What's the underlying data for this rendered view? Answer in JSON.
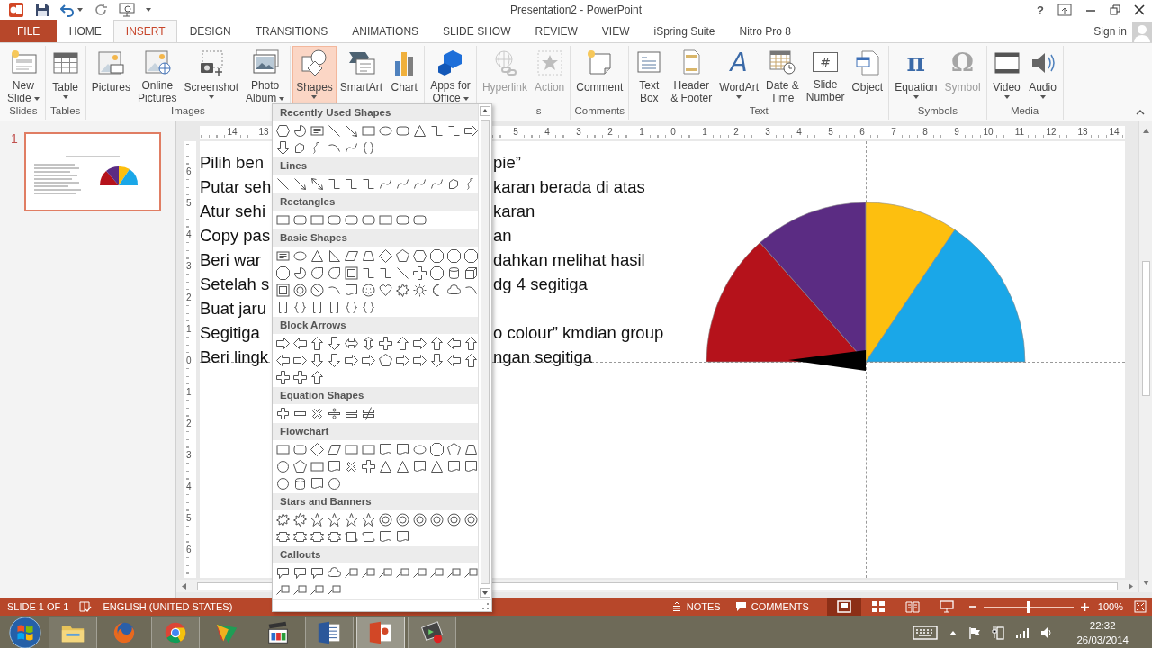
{
  "window": {
    "title": "Presentation2 - PowerPoint",
    "help": "?",
    "sign_in": "Sign in"
  },
  "tabs": [
    {
      "label": "FILE",
      "kind": "file",
      "selected": false
    },
    {
      "label": "HOME",
      "kind": "tab",
      "selected": false
    },
    {
      "label": "INSERT",
      "kind": "tab",
      "selected": true
    },
    {
      "label": "DESIGN",
      "kind": "tab",
      "selected": false
    },
    {
      "label": "TRANSITIONS",
      "kind": "tab",
      "selected": false
    },
    {
      "label": "ANIMATIONS",
      "kind": "tab",
      "selected": false
    },
    {
      "label": "SLIDE SHOW",
      "kind": "tab",
      "selected": false
    },
    {
      "label": "REVIEW",
      "kind": "tab",
      "selected": false
    },
    {
      "label": "VIEW",
      "kind": "tab",
      "selected": false
    },
    {
      "label": "iSpring Suite",
      "kind": "tab",
      "selected": false
    },
    {
      "label": "Nitro Pro 8",
      "kind": "tab",
      "selected": false
    }
  ],
  "ribbon": {
    "groups": [
      {
        "label": "Slides",
        "buttons": [
          {
            "label": "New\nSlide",
            "menu": true,
            "active": false,
            "disabled": false
          }
        ]
      },
      {
        "label": "Tables",
        "buttons": [
          {
            "label": "Table",
            "menu": true,
            "active": false,
            "disabled": false
          }
        ]
      },
      {
        "label": "Images",
        "buttons": [
          {
            "label": "Pictures",
            "menu": false,
            "active": false,
            "disabled": false
          },
          {
            "label": "Online\nPictures",
            "menu": false,
            "active": false,
            "disabled": false
          },
          {
            "label": "Screenshot",
            "menu": true,
            "active": false,
            "disabled": false
          },
          {
            "label": "Photo\nAlbum",
            "menu": true,
            "active": false,
            "disabled": false
          }
        ]
      },
      {
        "buttons": [
          {
            "label": "Shapes",
            "menu": true,
            "active": true,
            "disabled": false
          },
          {
            "label": "SmartArt",
            "menu": false,
            "active": false,
            "disabled": false
          },
          {
            "label": "Chart",
            "menu": false,
            "active": false,
            "disabled": false
          }
        ]
      },
      {
        "buttons": [
          {
            "label": "Apps for\nOffice",
            "menu": true,
            "active": false,
            "disabled": false
          }
        ]
      },
      {
        "label": "s",
        "buttons": [
          {
            "label": "Hyperlink",
            "menu": false,
            "active": false,
            "disabled": true
          },
          {
            "label": "Action",
            "menu": false,
            "active": false,
            "disabled": true
          }
        ]
      },
      {
        "label": "Comments",
        "buttons": [
          {
            "label": "Comment",
            "menu": false,
            "active": false,
            "disabled": false
          }
        ]
      },
      {
        "label": "Text",
        "buttons": [
          {
            "label": "Text\nBox",
            "menu": false,
            "active": false,
            "disabled": false
          },
          {
            "label": "Header\n& Footer",
            "menu": false,
            "active": false,
            "disabled": false
          },
          {
            "label": "WordArt",
            "glyph": "A",
            "menu": true,
            "active": false,
            "disabled": false
          },
          {
            "label": "Date &\nTime",
            "menu": false,
            "active": false,
            "disabled": false
          },
          {
            "label": "Slide\nNumber",
            "glyph": "#",
            "menu": false,
            "active": false,
            "disabled": false
          },
          {
            "label": "Object",
            "menu": false,
            "active": false,
            "disabled": false
          }
        ]
      },
      {
        "label": "Symbols",
        "buttons": [
          {
            "label": "Equation",
            "glyph": "π",
            "menu": true,
            "active": false,
            "disabled": false
          },
          {
            "label": "Symbol",
            "glyph": "Ω",
            "menu": false,
            "active": false,
            "disabled": true
          }
        ]
      },
      {
        "label": "Media",
        "buttons": [
          {
            "label": "Video",
            "menu": true,
            "active": false,
            "disabled": false
          },
          {
            "label": "Audio",
            "menu": true,
            "active": false,
            "disabled": false
          }
        ]
      }
    ]
  },
  "slides_pane": {
    "thumbnails": [
      {
        "number": "1",
        "selected": true
      }
    ]
  },
  "rulers": {
    "horizontal": [
      "14",
      "13",
      "5",
      "4",
      "3",
      "2",
      "1",
      "0",
      "1",
      "2",
      "3",
      "4",
      "5",
      "6",
      "7",
      "8",
      "9",
      "10",
      "11",
      "12",
      "13",
      "14"
    ],
    "vertical": [
      "6",
      "5",
      "4",
      "3",
      "2",
      "1",
      "0",
      "1",
      "2",
      "3",
      "4",
      "5",
      "6"
    ]
  },
  "slide": {
    "lines": [
      {
        "left": "Pilih ben",
        "right": "pie”"
      },
      {
        "left": "Putar seh",
        "right": "karan berada di atas"
      },
      {
        "left": "Atur sehi",
        "right": "karan"
      },
      {
        "left": "Copy pas",
        "right": "an"
      },
      {
        "left": "Beri war",
        "right": "dahkan melihat hasil"
      },
      {
        "left": "Setelah s",
        "right": "dg 4 segitiga"
      },
      {
        "left": "Buat jaru"
      },
      {
        "left": "Segitiga",
        "right": "o colour” kmdian group"
      },
      {
        "left": "Beri lingk",
        "right": "ngan segitiga"
      }
    ]
  },
  "shapes_menu": {
    "sections": [
      {
        "title": "Recently Used Shapes"
      },
      {
        "title": "Lines"
      },
      {
        "title": "Rectangles"
      },
      {
        "title": "Basic Shapes"
      },
      {
        "title": "Block Arrows"
      },
      {
        "title": "Equation Shapes"
      },
      {
        "title": "Flowchart"
      },
      {
        "title": "Stars and Banners"
      },
      {
        "title": "Callouts"
      }
    ]
  },
  "status_bar": {
    "slide_info": "SLIDE 1 OF 1",
    "language": "ENGLISH (UNITED STATES)",
    "notes": "NOTES",
    "comments": "COMMENTS",
    "views": [
      {
        "selected": true
      },
      {
        "selected": false
      },
      {
        "selected": false
      },
      {
        "selected": false
      }
    ],
    "zoom": {
      "level": 0.5,
      "reading": "100%"
    }
  },
  "taskbar": {
    "apps": [
      {
        "running": true,
        "selected": false
      },
      {
        "running": false,
        "selected": false
      },
      {
        "running": true,
        "selected": false
      },
      {
        "running": false,
        "selected": false
      },
      {
        "running": false,
        "selected": false
      },
      {
        "running": true,
        "selected": false
      },
      {
        "running": true,
        "selected": true
      },
      {
        "running": true,
        "selected": false
      }
    ],
    "clock": {
      "time": "22:32",
      "date": "26/03/2014"
    }
  }
}
